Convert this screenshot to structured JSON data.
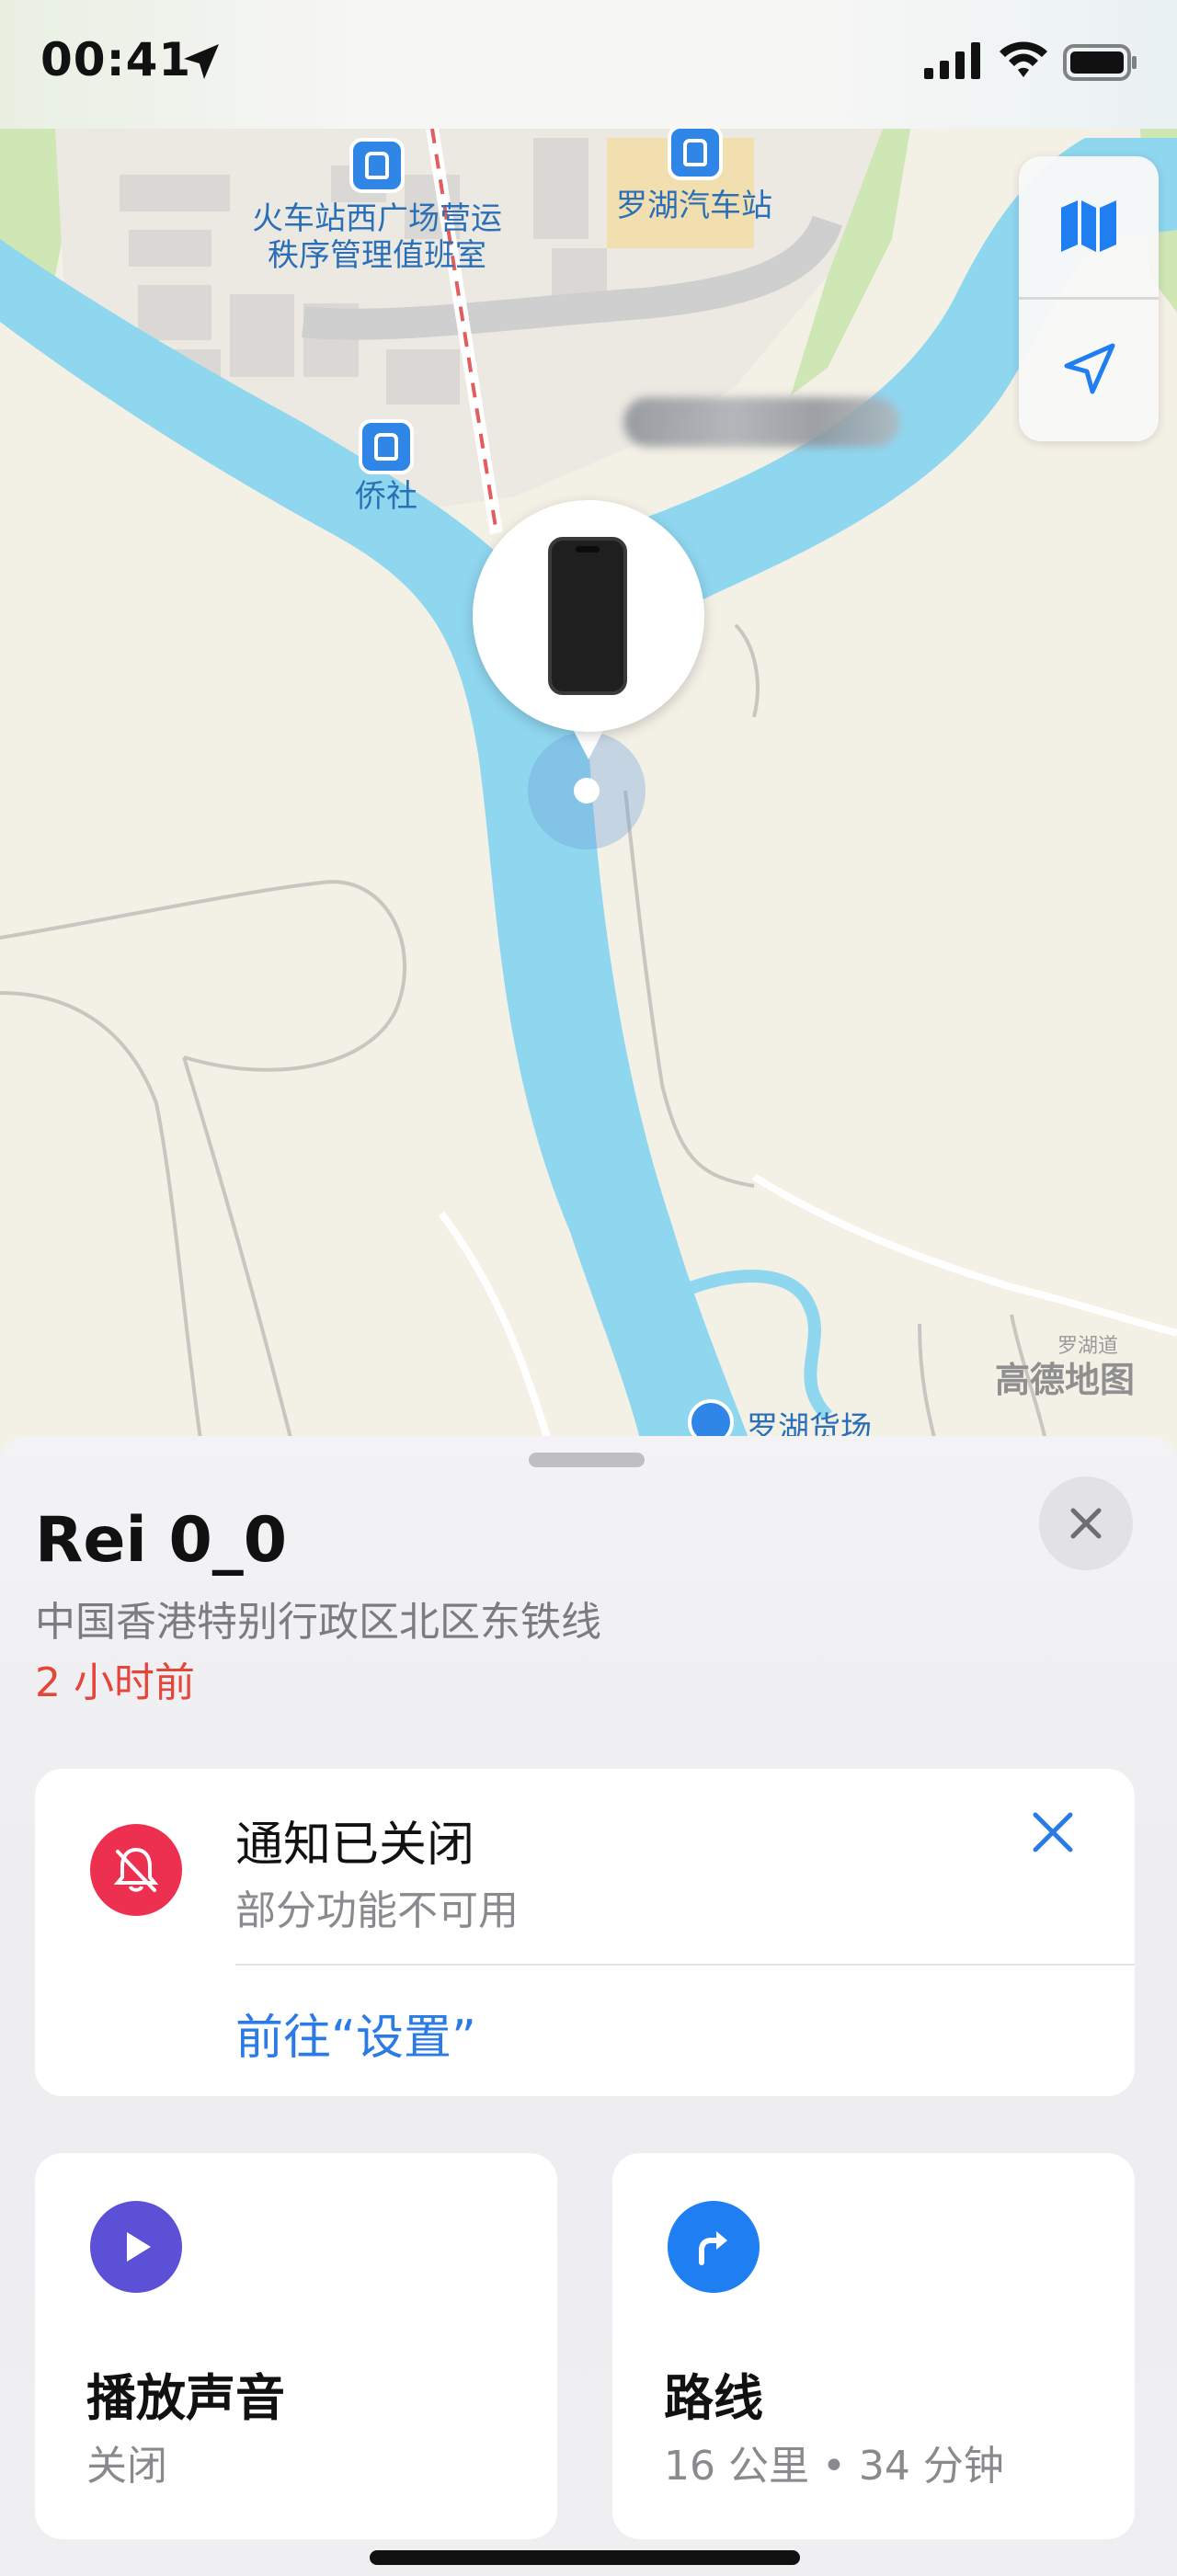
{
  "status_bar": {
    "time": "00:41",
    "icons": [
      "location-arrow-icon",
      "cellular-signal-icon",
      "wifi-icon",
      "battery-icon"
    ]
  },
  "map": {
    "poi": [
      {
        "name": "火车站西广场营运",
        "name2": "秩序管理值班室",
        "icon": "bus-station-icon"
      },
      {
        "name": "罗湖汽车站",
        "icon": "bus-station-icon"
      },
      {
        "name": "侨社",
        "icon": "metro-station-icon"
      },
      {
        "name": "罗湖货场",
        "icon": "location-icon"
      }
    ],
    "road_label": "罗湖道",
    "provider": "高德地图",
    "controls": [
      "map-mode-icon",
      "locate-me-icon"
    ]
  },
  "device": {
    "name": "Rei 0_0",
    "address": "中国香港特别行政区北区东铁线",
    "last_seen": "2 小时前"
  },
  "notification": {
    "title": "通知已关闭",
    "subtitle": "部分功能不可用",
    "action": "前往“设置”",
    "icon": "bell-slash-icon"
  },
  "actions": {
    "play_sound": {
      "title": "播放声音",
      "status": "关闭",
      "icon": "play-icon",
      "color": "#5b50d6"
    },
    "directions": {
      "title": "路线",
      "status": "16 公里 • 34 分钟",
      "icon": "turn-right-arrow-icon",
      "color": "#1f7ff2"
    }
  },
  "colors": {
    "water": "#8fd6ef",
    "land": "#f3f0e6",
    "accent_blue": "#2b7be6",
    "alert_red": "#e5453a"
  }
}
